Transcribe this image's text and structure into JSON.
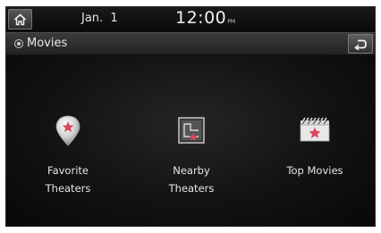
{
  "status": {
    "date": "Jan.  1",
    "time": "12:00",
    "ampm": "PM"
  },
  "header": {
    "title": "Movies",
    "title_icon": "radio-target-icon",
    "back_icon": "back-arrow-icon",
    "home_icon": "home-icon"
  },
  "menu": {
    "items": [
      {
        "line1": "Favorite",
        "line2": "Theaters",
        "icon": "favorite-pin-icon"
      },
      {
        "line1": "Nearby",
        "line2": "Theaters",
        "icon": "nearby-map-icon"
      },
      {
        "line1": "Top Movies",
        "line2": "",
        "icon": "clapperboard-star-icon"
      }
    ]
  },
  "colors": {
    "accent": "#d9475a",
    "background": "#0b0b0b",
    "text": "#e4e4e4"
  }
}
